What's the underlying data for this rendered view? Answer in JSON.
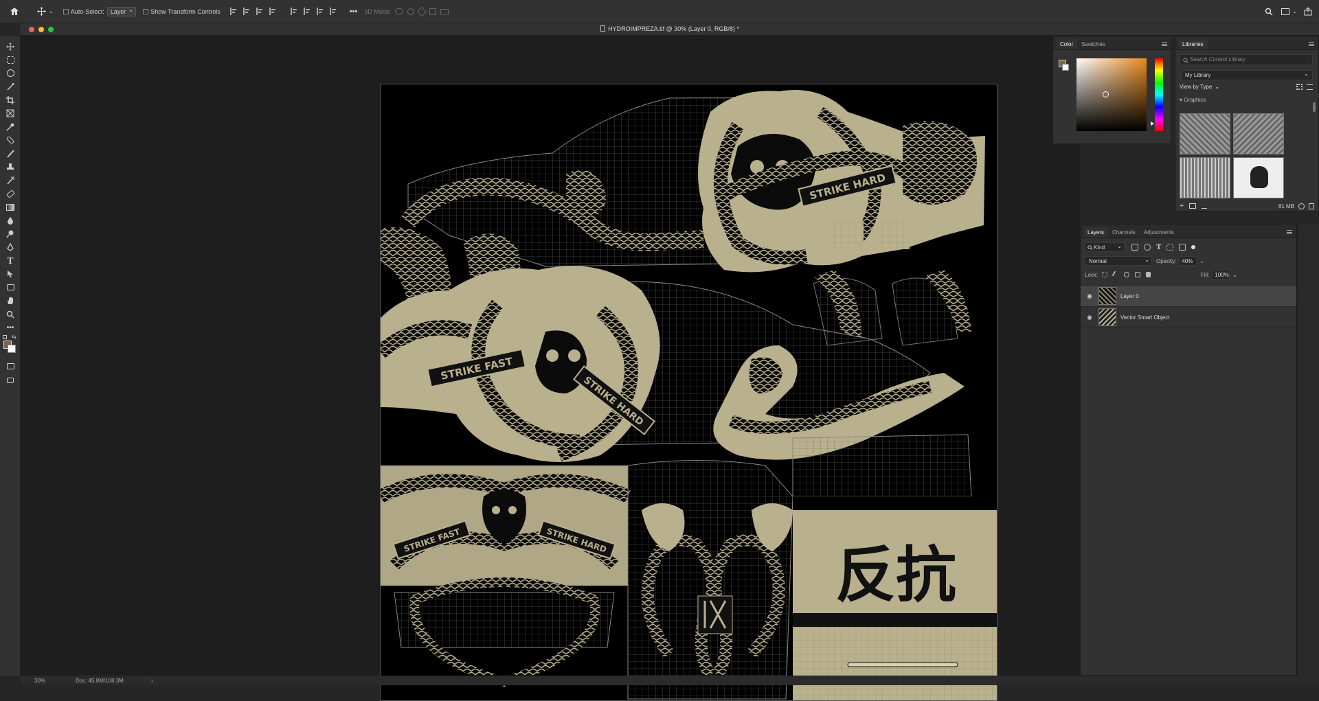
{
  "options_bar": {
    "auto_select_label": "Auto-Select:",
    "auto_select_value": "Layer",
    "transform_controls_label": "Show Transform Controls",
    "more_label": "•••",
    "mode_3d_label": "3D Mode:"
  },
  "document": {
    "title": "HYDROIMPREZA.tif @ 30% (Layer 0, RGB/8) *"
  },
  "artwork": {
    "text_strike_hard": "STRIKE HARD",
    "text_strike_fast": "STRIKE FAST",
    "text_kanji": "反抗"
  },
  "status_bar": {
    "zoom": "30%",
    "doc_size": "Doc: 45.8M/108.3M",
    "arrow": "›"
  },
  "color_panel": {
    "tabs": [
      "Color",
      "Swatches"
    ],
    "foreground": "#7a6447",
    "background": "#ffffff"
  },
  "libraries_panel": {
    "tab": "Libraries",
    "search_placeholder": "Search Current Library",
    "library_name": "My Library",
    "view_by": "View by Type",
    "section": "Graphics",
    "storage": "81 MB"
  },
  "layers_panel": {
    "tabs": [
      "Layers",
      "Channels",
      "Adjustments"
    ],
    "filter_kind": "Kind",
    "blend_mode": "Normal",
    "opacity_label": "Opacity:",
    "opacity_value": "40%",
    "lock_label": "Lock:",
    "fill_label": "Fill:",
    "fill_value": "100%",
    "layers": [
      {
        "name": "Layer 0",
        "selected": true
      },
      {
        "name": "Vector Smart Object",
        "selected": false
      }
    ]
  },
  "colors": {
    "accent_tan": "#b9b08e",
    "panel_bg": "#323232",
    "canvas_bg": "#000000"
  }
}
